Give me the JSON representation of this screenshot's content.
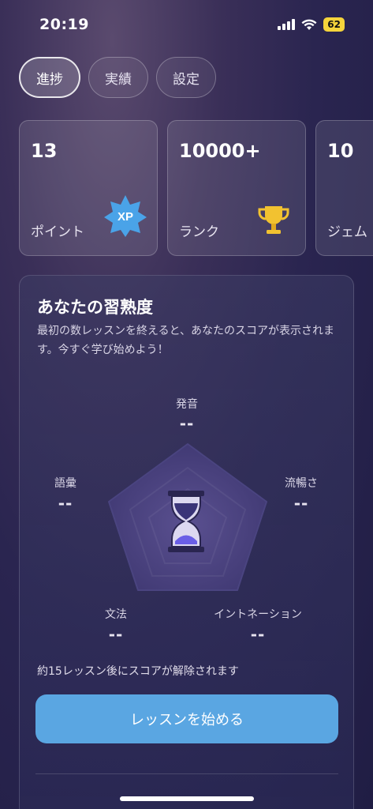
{
  "status": {
    "time": "20:19",
    "battery": "62"
  },
  "tabs": [
    {
      "label": "進捗",
      "active": true
    },
    {
      "label": "実績",
      "active": false
    },
    {
      "label": "設定",
      "active": false
    }
  ],
  "stats": [
    {
      "value": "13",
      "label": "ポイント",
      "icon": "xp-badge-icon",
      "badge_text": "XP"
    },
    {
      "value": "10000+",
      "label": "ランク",
      "icon": "trophy-icon"
    },
    {
      "value": "10",
      "label": "ジェム"
    }
  ],
  "proficiency": {
    "title": "あなたの習熟度",
    "description": "最初の数レッスンを終えると、あなたのスコアが表示されます。今すぐ学び始めよう！",
    "axes": {
      "pronunciation": {
        "label": "発音",
        "value": "--"
      },
      "fluency": {
        "label": "流暢さ",
        "value": "--"
      },
      "intonation": {
        "label": "イントネーション",
        "value": "--"
      },
      "grammar": {
        "label": "文法",
        "value": "--"
      },
      "vocabulary": {
        "label": "語彙",
        "value": "--"
      }
    },
    "center_icon": "hourglass-icon",
    "unlock_note": "約15レッスン後にスコアが解除されます",
    "start_button": "レッスンを始める"
  },
  "colors": {
    "accent": "#5aa6e2",
    "xp_badge": "#4aa3e8",
    "trophy": "#f2c230"
  }
}
